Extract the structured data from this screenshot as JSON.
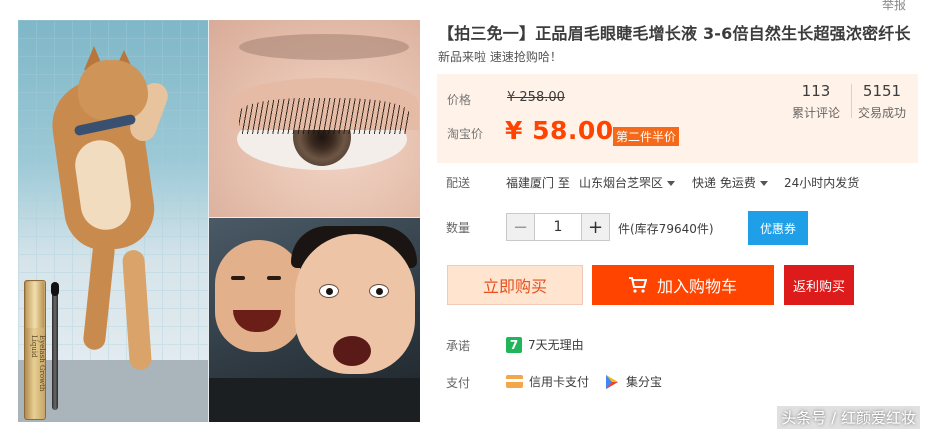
{
  "header": {
    "report": "举报"
  },
  "product": {
    "title": "【拍三免一】正品眉毛眼睫毛增长液 3-6倍自然生长超强浓密纤长",
    "subtitle": "新品来啦 速速抢购哈！",
    "bottle_text": "Eyelash Growth Liquid"
  },
  "price": {
    "price_label": "价格",
    "original": "¥ 258.00",
    "taobao_label": "淘宝价",
    "current": "¥ 58.00",
    "promo": "第二件半价"
  },
  "stats": {
    "reviews_count": "113",
    "reviews_label": "累计评论",
    "deals_count": "5151",
    "deals_label": "交易成功"
  },
  "shipping": {
    "label": "配送",
    "from": "福建厦门 至",
    "to": "山东烟台芝罘区",
    "method": "快递 免运费",
    "dispatch": "24小时内发货"
  },
  "quantity": {
    "label": "数量",
    "minus": "−",
    "plus": "+",
    "value": "1",
    "stock": "件(库存79640件)",
    "coupon": "优惠券"
  },
  "actions": {
    "buy_now": "立即购买",
    "add_cart": "加入购物车",
    "rebate": "返利购买"
  },
  "promise": {
    "label": "承诺",
    "icon_text": "7",
    "text": "7天无理由"
  },
  "payment": {
    "label": "支付",
    "credit": "信用卡支付",
    "jfb": "集分宝"
  },
  "watermark": "头条号 / 红颜爱红妆",
  "colors": {
    "price_orange": "#ff4400",
    "price_bg": "#fff2e8",
    "coupon_blue": "#1e9fe8",
    "rebate_red": "#de1b1b",
    "promise_green": "#21b55a"
  },
  "icons": [
    "cart-icon",
    "credit-card-icon",
    "jifenbao-icon",
    "seven-day-icon",
    "dropdown-triangle-icon"
  ]
}
